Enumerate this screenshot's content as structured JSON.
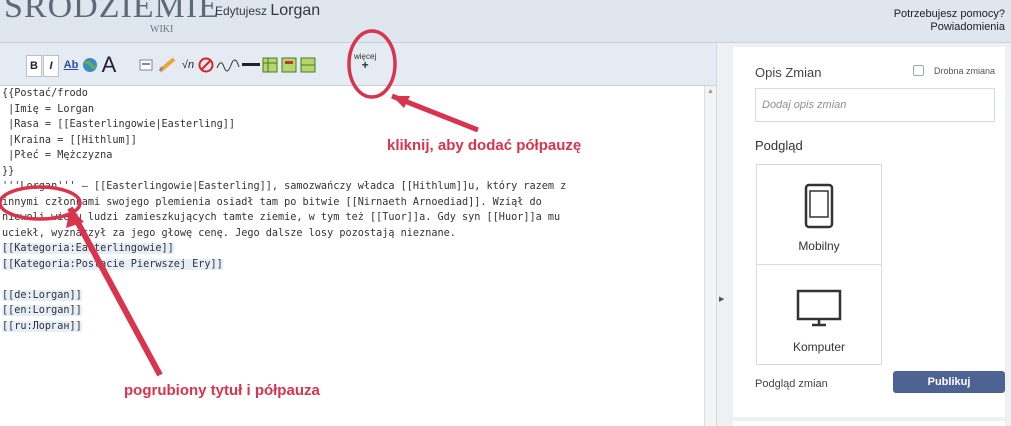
{
  "header": {
    "logo_text": "ŚRODZIEMIE",
    "logo_sub": "WIKI",
    "editing_prefix": "Edytujesz",
    "editing_title": "Lorgan",
    "help_link": "Potrzebujesz pomocy?",
    "notifications_link": "Powiadomienia"
  },
  "toolbar": {
    "more_label": "więcej",
    "more_plus": "+",
    "buttons": [
      "bold",
      "italic",
      "internal-link",
      "external-link",
      "headline",
      "image",
      "media",
      "math",
      "nowiki",
      "signature",
      "horizontal-line",
      "table",
      "insert-1",
      "insert-2"
    ]
  },
  "editor": {
    "lines": [
      "{{Postać/frodo",
      " |Imię = Lorgan",
      " |Rasa = [[Easterlingowie|Easterling]]",
      " |Kraina = [[Hithlum]]",
      " |Płeć = Mężczyzna",
      "}}",
      "'''Lorgan''' – [[Easterlingowie|Easterling]], samozwańczy władca [[Hithlum]]u, który razem z",
      "innymi członkami swojego plemienia osiadł tam po bitwie [[Nirnaeth Arnoediad]]. Wziął do",
      "niewoli wielu ludzi zamieszkujących tamte ziemie, w tym też [[Tuor]]a. Gdy syn [[Huor]]a mu",
      "uciekł, wyznaczył za jego głowę cenę. Jego dalsze losy pozostają nieznane.",
      "[[Kategoria:Easterlingowie]]",
      "[[Kategoria:Postacie Pierwszej Ery]]",
      "",
      "[[de:Lorgan]]",
      "[[en:Lorgan]]",
      "[[ru:Лорган]]"
    ]
  },
  "panel": {
    "summary_label": "Opis Zmian",
    "minor_edit_label": "Drobna zmiana",
    "summary_placeholder": "Dodaj opis zmian",
    "preview_label": "Podgląd",
    "mobile_label": "Mobilny",
    "desktop_label": "Komputer",
    "show_changes": "Podgląd zmian",
    "publish": "Publikuj"
  },
  "annotations": {
    "dash_hint": "kliknij, aby dodać półpauzę",
    "bold_hint": "pogrubiony tytuł i półpauza"
  },
  "colors": {
    "annotation": "#d8344d",
    "publish": "#4d6394",
    "header_bg": "#dfe6ee"
  }
}
